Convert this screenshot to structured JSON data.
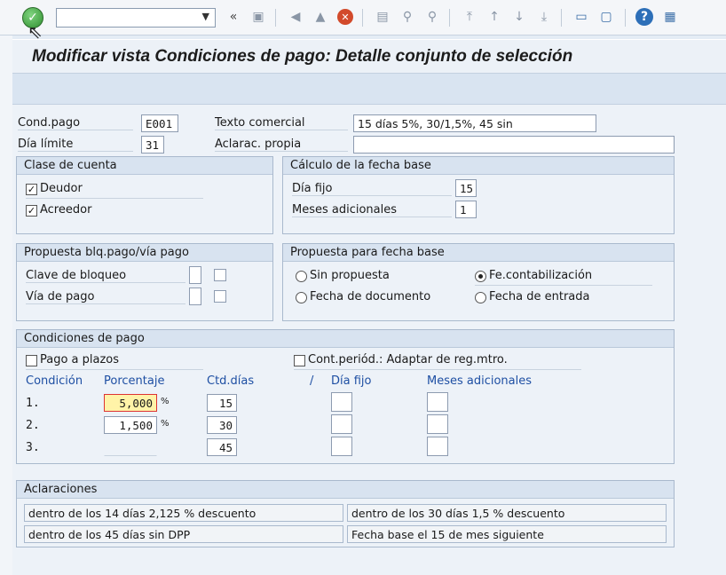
{
  "toolbar": {
    "command_value": "",
    "icons": [
      "check-icon",
      "dropdown-icon",
      "back-double-icon",
      "save-icon",
      "back-icon",
      "exit-icon",
      "cancel-icon",
      "print-icon",
      "find-icon",
      "find-next-icon",
      "first-page-icon",
      "prev-page-icon",
      "next-page-icon",
      "last-page-icon",
      "new-session-icon",
      "shortcut-icon",
      "help-icon",
      "layout-icon"
    ]
  },
  "title": "Modificar vista Condiciones de pago: Detalle conjunto de selección",
  "header": {
    "cond_pago_label": "Cond.pago",
    "cond_pago_value": "E001",
    "texto_comercial_label": "Texto comercial",
    "texto_comercial_value": "15 días 5%, 30/1,5%, 45 sin",
    "dia_limite_label": "Día límite",
    "dia_limite_value": "31",
    "aclarac_label": "Aclarac. propia",
    "aclarac_value": ""
  },
  "clase_cuenta": {
    "title": "Clase de cuenta",
    "deudor_label": "Deudor",
    "deudor_checked": true,
    "acreedor_label": "Acreedor",
    "acreedor_checked": true
  },
  "calculo_fecha": {
    "title": "Cálculo de la fecha base",
    "dia_fijo_label": "Día fijo",
    "dia_fijo_value": "15",
    "meses_label": "Meses adicionales",
    "meses_value": "1"
  },
  "propuesta_bloqueo": {
    "title": "Propuesta blq.pago/vía pago",
    "clave_label": "Clave de bloqueo",
    "via_label": "Vía de pago"
  },
  "propuesta_fecha": {
    "title": "Propuesta para fecha base",
    "sin_propuesta": "Sin propuesta",
    "fe_contab": "Fe.contabilización",
    "fecha_documento": "Fecha de documento",
    "fecha_entrada": "Fecha de entrada",
    "selected": "fe_contab"
  },
  "condiciones": {
    "title": "Condiciones de pago",
    "pago_plazos_label": "Pago a plazos",
    "cont_periodo_label": "Cont.periód.: Adaptar de reg.mtro.",
    "headers": {
      "condicion": "Condición",
      "porcentaje": "Porcentaje",
      "ctd_dias": "Ctd.días",
      "slash": "/",
      "dia_fijo": "Día fijo",
      "meses": "Meses adicionales"
    },
    "rows": [
      {
        "n": "1.",
        "pct": "5,000",
        "pct_sign": "%",
        "dias": "15"
      },
      {
        "n": "2.",
        "pct": "1,500",
        "pct_sign": "%",
        "dias": "30"
      },
      {
        "n": "3.",
        "pct": "",
        "pct_sign": "",
        "dias": "45"
      }
    ]
  },
  "aclaraciones": {
    "title": "Aclaraciones",
    "lines": [
      "dentro de los 14 días 2,125 % descuento",
      "dentro de los 30 días 1,5 % descuento",
      "dentro de los 45 días sin DPP",
      "Fecha base el 15 de mes siguiente"
    ]
  }
}
